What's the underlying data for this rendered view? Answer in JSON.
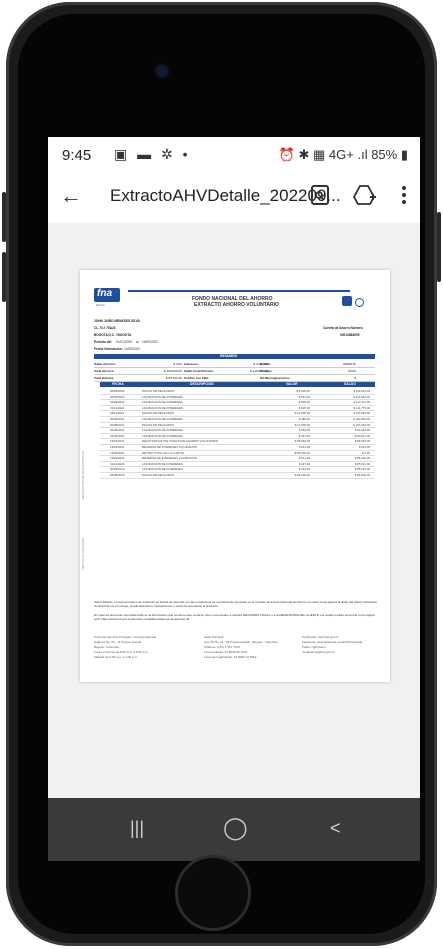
{
  "status_bar": {
    "time": "9:45",
    "left_icons": "▣ ▬ ✲ •",
    "right_icons": "⏰ ✱ ▦ 4G+ .ıl 85% ▮"
  },
  "app_bar": {
    "title": "ExtractoAHVDetalle_202209..."
  },
  "document": {
    "logo": "fna",
    "logo_sub": "ahorro",
    "header_title_1": "FONDO NACIONAL DEL AHORRO",
    "header_title_2": "EXTRACTO AHORRO VOLUNTARIO",
    "client_name": "JOHN JAIRO MENESES SILVA",
    "client_id": "CL 74 # 75A21",
    "client_city": "BOGOTA D.C. / BOGOTA",
    "account_label": "Cuenta de Ahorro Número",
    "account_number": "04013884699",
    "period_label": "Período del",
    "period_from": "01/01/2020",
    "period_al": "al",
    "period_to": "14/09/2022",
    "gen_label": "Fecha Generación:",
    "gen_date": "14/09/2022",
    "summary_title": "RESUMEN",
    "summary_rows": [
      [
        "Saldo Anterior:",
        "$ 0.00",
        "Intereses:",
        "$ 4,253.00",
        "Estado:",
        "ABIERTA"
      ],
      [
        "Total Abonos:",
        "$ 200,000.00",
        "Saldo Final Periodo:",
        "$ 118,642.00",
        "Pontaje:",
        "99.00"
      ],
      [
        "Total Débitos:",
        "$ 85,611.00",
        "Crédito con FNA:",
        "NO",
        "No. Consignaciones",
        "6"
      ]
    ],
    "columns": [
      "FECHA",
      "DESCRIPCIÓN",
      "VALOR",
      "SALDO"
    ],
    "rows": [
      [
        "06/08/2022",
        "PAGOS DE RECAUDOS",
        "$ 5,000.00",
        "$ 118,642.00"
      ],
      [
        "30/06/2022",
        "LIQUIDACION DE INTERESES",
        "$ 931.00",
        "$ 113,642.00"
      ],
      [
        "31/03/2022",
        "LIQUIDACION DE INTERESES",
        "$ 936.00",
        "$ 112,711.00"
      ],
      [
        "31/12/2021",
        "LIQUIDACION DE INTERESES",
        "$ 826.00",
        "$ 111,775.00"
      ],
      [
        "28/11/2021",
        "PAGOS DE RECAUDOS",
        "$ 10,000.00",
        "$ 110,949.00"
      ],
      [
        "30/09/2021",
        "LIQUIDACION DE INTERESES",
        "$ 485.00",
        "$ 100,949.00"
      ],
      [
        "20/08/2021",
        "PAGOS DE RECAUDOS",
        "$ 10,000.00",
        "$ 100,464.00"
      ],
      [
        "30/06/2021",
        "LIQUIDACION DE INTERESES",
        "$ 453.00",
        "$ 90,464.00"
      ],
      [
        "31/03/2021",
        "LIQUIDACION DE INTERESES",
        "$ 451.00",
        "$ 90,011.00"
      ],
      [
        "19/02/2021",
        "REACTIVACION DE CUENTA DE AHORRO VOLUNTARIO",
        "$ 89,560.00",
        "$ 89,560.00"
      ],
      [
        "19/02/2021",
        "REVERSO DE INTERESES LIQUIDADOS",
        "$ 611.00",
        "$ 611.00"
      ],
      [
        "19/02/2021",
        "RETIRO TOTAL DE LA CUENTA",
        "-$ 85,000.00",
        "$ 0.00"
      ],
      [
        "19/02/2021",
        "REVERSO DE INTERESES LIQUIDADOS",
        "-$ 611.00",
        "$ 85,000.00"
      ],
      [
        "31/12/2020",
        "LIQUIDACION DE INTERESES",
        "$ 447.00",
        "$ 85,611.00"
      ],
      [
        "30/09/2020",
        "LIQUIDACION DE INTERESES",
        "$ 164.00",
        "$ 85,164.00"
      ],
      [
        "26/08/2020",
        "PAGOS DE RECAUDOS",
        "$ 85,000.00",
        "$ 85,000.00"
      ]
    ],
    "note_1": "Señor Afiliado, el reconocimiento de intereses se liquida de acuerdo con las condiciones de cumplimiento previstas en el contrato. El Fondo Nacional del Ahorro no cobra cuota alguna al titular del Ahorro Voluntario Contractual por el manejo, la administración, transacciones y servicios asociados al producto.",
    "note_2": "En caso de encontrar inconsistencias en la información que contiene este extracto, favor comunicarlo a nuestra REVISORÍA FISCAL o a la DEFENSORÍA DEL CLIENTE, los cuales podrán encontrar en la página web: https://www.fna.gov.co/atencion-ciudadano/sistema-de-atencion-al",
    "footer_col1": [
      "Punto de Atención Principal - Correspondencia",
      "Calle 12 No. 65 - 11 Puente Aranda",
      "Bogotá - Colombia",
      "Lunes a viernes de 8:00 a.m. a 5:00 p.m.",
      "Sábado de 9:00 a.m. a 1:00 p.m."
    ],
    "footer_col2": [
      "Sede Principal",
      "Cra. 65 No. 11 - 83 Puente Aranda , Bogotá - Colombia",
      "Teléfono: (+57) 1 307 7070",
      "Línea Gratuita: 01 8000 52 7070",
      "Línea de legalización: 01 8000 12 5562"
    ],
    "footer_col3": [
      "Portal web: www.fna.gov.co",
      "Facebook: www.facebook.com/FNAColombia",
      "Twitter: @Fnaturo",
      "contactenos@fna.gov.co"
    ],
    "side_text_1": "SERVICIOS VIRTUALES ALTERNATIVOS",
    "side_text_2": "SERVICIO AL CIUDADANO"
  },
  "nav_bar": {
    "recents": "|||",
    "home": "◯",
    "back": "<"
  },
  "colors": {
    "brand_blue": "#1f4e9c",
    "table_header": "#1f4e9c",
    "nav_bar": "#3a3a3a"
  }
}
